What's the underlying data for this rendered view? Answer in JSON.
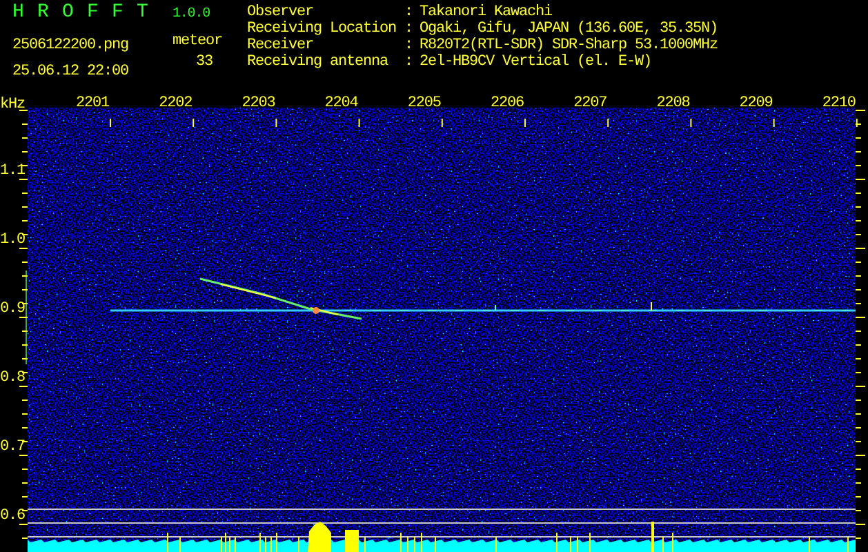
{
  "app": {
    "name": "HROFFT",
    "version": "1.0.0"
  },
  "file": "2506122200.png",
  "timestamp": "25.06.12 22:00",
  "meteor": {
    "label": "meteor",
    "count": "33"
  },
  "station": [
    {
      "label": "Observer",
      "separator": ":",
      "value": "Takanori Kawachi"
    },
    {
      "label": "Receiving Location",
      "separator": ":",
      "value": "Ogaki, Gifu, JAPAN (136.60E, 35.35N)"
    },
    {
      "label": "Receiver",
      "separator": ":",
      "value": "R820T2(RTL-SDR) SDR-Sharp 53.1000MHz"
    },
    {
      "label": "Receiving antenna",
      "separator": ":",
      "value": "2el-HB9CV Vertical (el. E-W)"
    }
  ],
  "spectrogram": {
    "unit": "kHz",
    "time_labels": [
      "2201",
      "2202",
      "2203",
      "2204",
      "2205",
      "2206",
      "2207",
      "2208",
      "2209",
      "2210"
    ],
    "frequency_labels": [
      "1.1",
      "1.0",
      "0.9",
      "0.8",
      "0.7",
      "0.6"
    ]
  }
}
